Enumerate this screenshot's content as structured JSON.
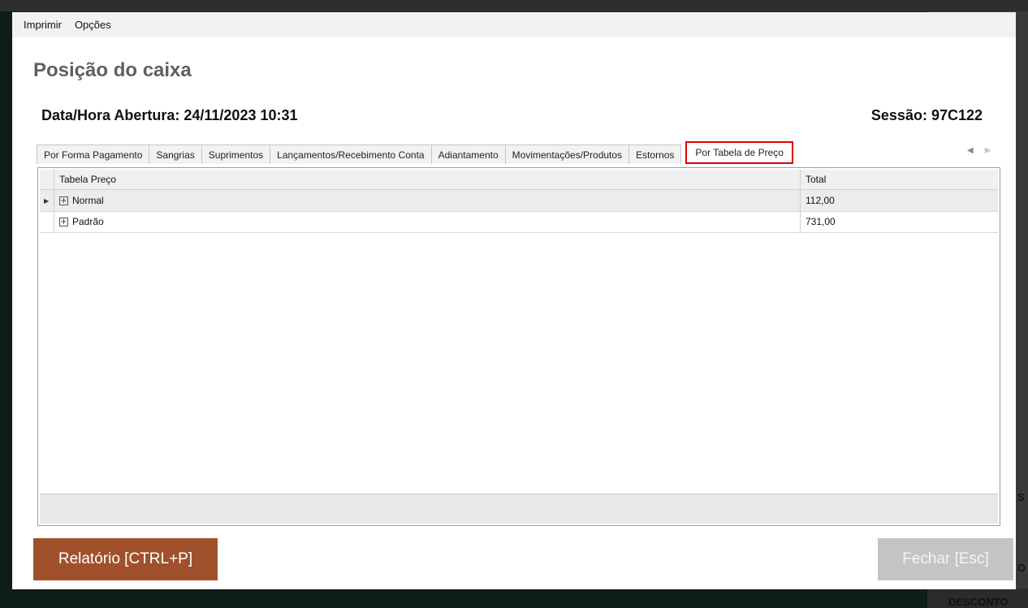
{
  "background": {
    "right_fragments": [
      "S",
      "O",
      "DESCONTO"
    ]
  },
  "menu": {
    "items": [
      "Imprimir",
      "Opções"
    ]
  },
  "page": {
    "title": "Posição do caixa",
    "opening_label": "Data/Hora Abertura: 24/11/2023 10:31",
    "session_label": "Sessão: 97C122"
  },
  "tabs": [
    {
      "label": "Por Forma Pagamento",
      "active": false
    },
    {
      "label": "Sangrias",
      "active": false
    },
    {
      "label": "Suprimentos",
      "active": false
    },
    {
      "label": "Lançamentos/Recebimento Conta",
      "active": false
    },
    {
      "label": "Adiantamento",
      "active": false
    },
    {
      "label": "Movimentações/Produtos",
      "active": false
    },
    {
      "label": "Estornos",
      "active": false
    },
    {
      "label": "Por Tabela de Preço",
      "active": true
    }
  ],
  "tab_nav": {
    "prev_icon": "triangle-left",
    "next_icon": "triangle-right"
  },
  "grid": {
    "columns": [
      "Tabela Preço",
      "Total"
    ],
    "rows": [
      {
        "name": "Normal",
        "total": "112,00",
        "selected": true
      },
      {
        "name": "Padrão",
        "total": "731,00",
        "selected": false
      }
    ]
  },
  "buttons": {
    "report": "Relatório [CTRL+P]",
    "close": "Fechar [Esc]"
  },
  "colors": {
    "report_button": "#a0512c",
    "close_button": "#c4c4c4",
    "active_tab_border": "#e00000"
  }
}
